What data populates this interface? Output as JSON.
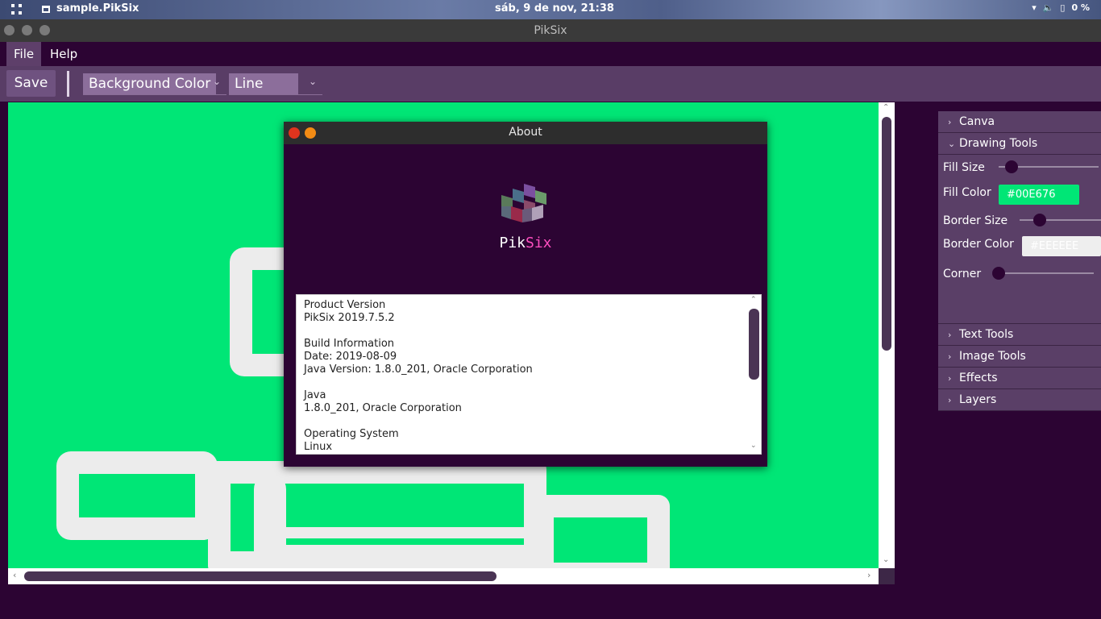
{
  "topbar": {
    "app_title": "sample.PikSix",
    "clock": "sáb,  9 de nov, 21:38",
    "battery": "0 %"
  },
  "window": {
    "title": "PikSix"
  },
  "menu": {
    "items": [
      "File",
      "Help"
    ]
  },
  "toolbar": {
    "save_label": "Save",
    "color_combo": "Background Color",
    "tool_combo": "Line"
  },
  "panel": {
    "canva": "Canva",
    "drawing_tools": "Drawing Tools",
    "fill_size_label": "Fill Size",
    "fill_size_value": 0.07,
    "fill_color_label": "Fill Color",
    "fill_color": "#00E676",
    "border_size_label": "Border Size",
    "border_size_value": 0.2,
    "border_color_label": "Border Color",
    "border_color": "#EEEEEE",
    "corner_label": "Corner",
    "corner_value": 0.0,
    "text_tools": "Text Tools",
    "image_tools": "Image Tools",
    "effects": "Effects",
    "layers": "Layers"
  },
  "about": {
    "title": "About",
    "brand_a": "Pik",
    "brand_b": "Six",
    "lines": [
      "Product Version",
      "PikSix 2019.7.5.2",
      "",
      "Build Information",
      "Date: 2019-08-09",
      "Java Version: 1.8.0_201, Oracle Corporation",
      "",
      "Java",
      "1.8.0_201, Oracle Corporation",
      "",
      "Operating System",
      "Linux"
    ]
  },
  "colors": {
    "canvas": "#00E676",
    "shape_border": "#ECECEC",
    "accent_purple": "#593D66",
    "background": "#2C0433"
  }
}
